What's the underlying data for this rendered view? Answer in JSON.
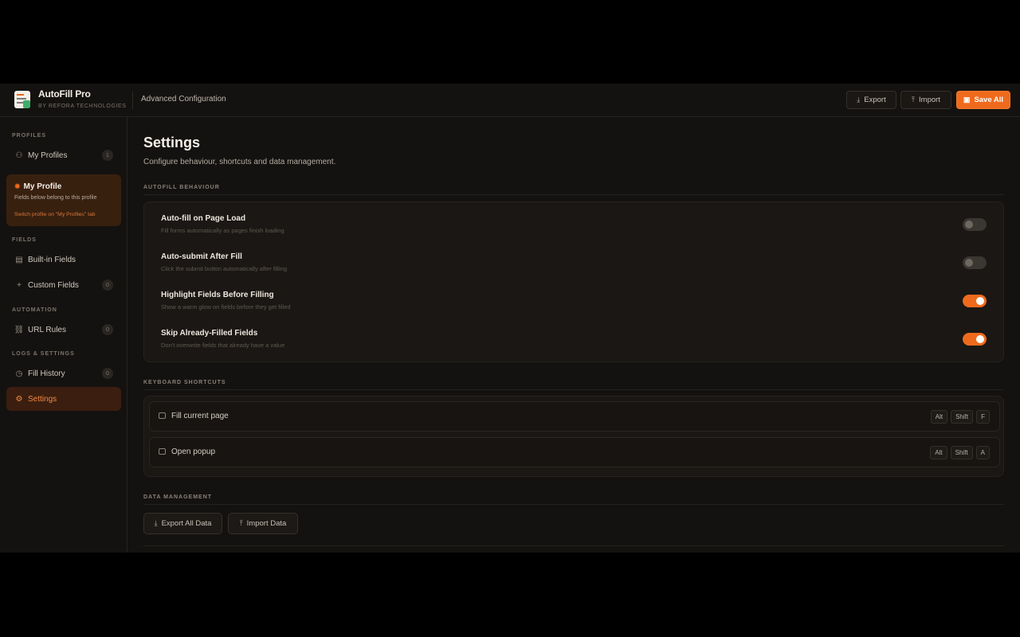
{
  "header": {
    "app_name": "AutoFill Pro",
    "app_byline": "BY REFORA TECHNOLOGIES",
    "page_context": "Advanced Configuration",
    "export_label": "Export",
    "import_label": "Import",
    "save_label": "Save All"
  },
  "sidebar": {
    "section_profiles": "PROFILES",
    "my_profiles": {
      "label": "My Profiles",
      "count": "1"
    },
    "profile_card": {
      "title": "My Profile",
      "desc": "Fields below belong to this profile",
      "hint": "Switch profile on \"My Profiles\" tab"
    },
    "section_fields": "FIELDS",
    "builtin_fields": {
      "label": "Built-in Fields"
    },
    "custom_fields": {
      "label": "Custom Fields",
      "count": "0"
    },
    "section_automation": "AUTOMATION",
    "url_rules": {
      "label": "URL Rules",
      "count": "0"
    },
    "section_logs": "LOGS & SETTINGS",
    "fill_history": {
      "label": "Fill History",
      "count": "0"
    },
    "settings": {
      "label": "Settings"
    }
  },
  "main": {
    "title": "Settings",
    "subtitle": "Configure behaviour, shortcuts and data management.",
    "autofill_heading": "AUTOFILL BEHAVIOUR",
    "toggles": [
      {
        "title": "Auto-fill on Page Load",
        "desc": "Fill forms automatically as pages finish loading",
        "on": false
      },
      {
        "title": "Auto-submit After Fill",
        "desc": "Click the submit button automatically after filling",
        "on": false
      },
      {
        "title": "Highlight Fields Before Filling",
        "desc": "Show a warm glow on fields before they get filled",
        "on": true
      },
      {
        "title": "Skip Already-Filled Fields",
        "desc": "Don't overwrite fields that already have a value",
        "on": true
      }
    ],
    "shortcuts_heading": "KEYBOARD SHORTCUTS",
    "shortcuts": [
      {
        "label": "Fill current page",
        "keys": [
          "Alt",
          "Shift",
          "F"
        ]
      },
      {
        "label": "Open popup",
        "keys": [
          "Alt",
          "Shift",
          "A"
        ]
      }
    ],
    "data_heading": "DATA MANAGEMENT",
    "export_all_label": "Export All Data",
    "import_data_label": "Import Data"
  },
  "colors": {
    "accent": "#ef6a1c",
    "background": "#141210",
    "card": "#1a1714"
  },
  "icons": {
    "export": "download-icon",
    "import": "upload-icon",
    "save": "save-icon"
  }
}
